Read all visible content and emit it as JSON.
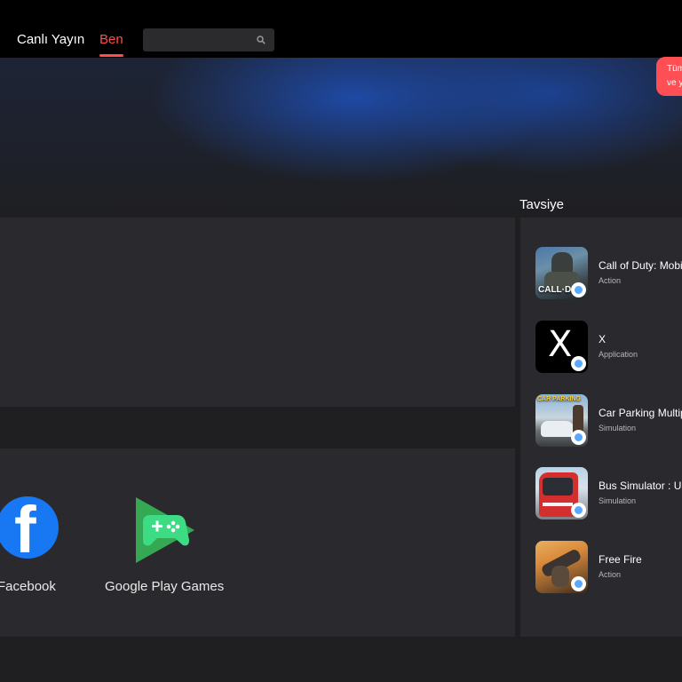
{
  "nav": {
    "tabs": [
      {
        "label": "Canlı Yayın"
      },
      {
        "label": "Ben"
      }
    ],
    "active_tab_color": "#ff4d4f",
    "search_placeholder": ""
  },
  "notification": {
    "line1": "Tüm",
    "line2": "ve y",
    "color": "#ff4f55"
  },
  "apps": [
    {
      "label": "Facebook",
      "icon": "facebook-icon"
    },
    {
      "label": "Google Play Games",
      "icon": "google-play-games-icon"
    }
  ],
  "recommendations": {
    "title": "Tavsiye",
    "items": [
      {
        "name": "Call of Duty: Mobile",
        "category": "Action",
        "icon": "call-of-duty-icon",
        "icon_text": "CALL·DU"
      },
      {
        "name": "X",
        "category": "Application",
        "icon": "x-icon",
        "icon_text": "X"
      },
      {
        "name": "Car Parking Multiplayer",
        "category": "Simulation",
        "icon": "car-parking-icon",
        "icon_text": "CAR PARKING"
      },
      {
        "name": "Bus Simulator : Ultimate",
        "category": "Simulation",
        "icon": "bus-simulator-icon",
        "icon_text": ""
      },
      {
        "name": "Free Fire",
        "category": "Action",
        "icon": "free-fire-icon",
        "icon_text": ""
      }
    ]
  }
}
